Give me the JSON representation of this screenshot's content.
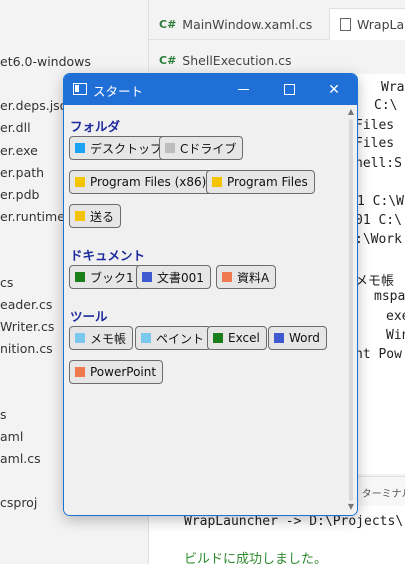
{
  "ide": {
    "explorer": {
      "items": [
        "et6.0-windows",
        "er.deps.json",
        "er.dll",
        "er.exe",
        "er.path",
        "er.pdb",
        "er.runtimeco",
        "cs",
        "eader.cs",
        "Writer.cs",
        "nition.cs",
        "s",
        "aml",
        "aml.cs",
        "csproj"
      ]
    },
    "tabs": [
      {
        "tag": "C#",
        "label": "MainWindow.xaml.cs"
      },
      {
        "tag": "",
        "label": "WrapLa"
      }
    ],
    "tabs2": [
      {
        "tag": "C#",
        "label": "ShellExecution.cs"
      }
    ],
    "editor_lines": [
      "Wra",
      "C:\\",
      "Files",
      "Files",
      "hell:S",
      "1 C:\\W",
      "01 C:\\",
      ":\\Work",
      "メモ帳",
      "mspa",
      "exe",
      "Win",
      "nt  Pow"
    ],
    "terminal": {
      "tab_label": "ターミナル",
      "lines": [
        "WrapLauncher -> D:\\Projects\\",
        "ビルドに成功しました。"
      ]
    }
  },
  "window": {
    "title": "スタート",
    "minimize_label": "—",
    "maximize_label": "☐",
    "close_label": "✕",
    "sections": [
      {
        "title": "フォルダ",
        "buttons": [
          {
            "label": "デスクトップ",
            "color": "#1aa3f5"
          },
          {
            "label": "Cドライブ",
            "color": "#bdbdbd"
          },
          {
            "label": "Program Files (x86)",
            "color": "#f5c400"
          },
          {
            "label": "Program Files",
            "color": "#f5c400"
          },
          {
            "label": "送る",
            "color": "#f5c400"
          }
        ]
      },
      {
        "title": "ドキュメント",
        "buttons": [
          {
            "label": "ブック1",
            "color": "#1a7f1a"
          },
          {
            "label": "文書001",
            "color": "#3f5ad1"
          },
          {
            "label": "資料A",
            "color": "#f07a50"
          }
        ]
      },
      {
        "title": "ツール",
        "buttons": [
          {
            "label": "メモ帳",
            "color": "#7cc9ef"
          },
          {
            "label": "ペイント",
            "color": "#7cc9ef"
          },
          {
            "label": "Excel",
            "color": "#1a7f1a"
          },
          {
            "label": "Word",
            "color": "#3f5ad1"
          },
          {
            "label": "PowerPoint",
            "color": "#f07a50"
          }
        ]
      }
    ]
  }
}
